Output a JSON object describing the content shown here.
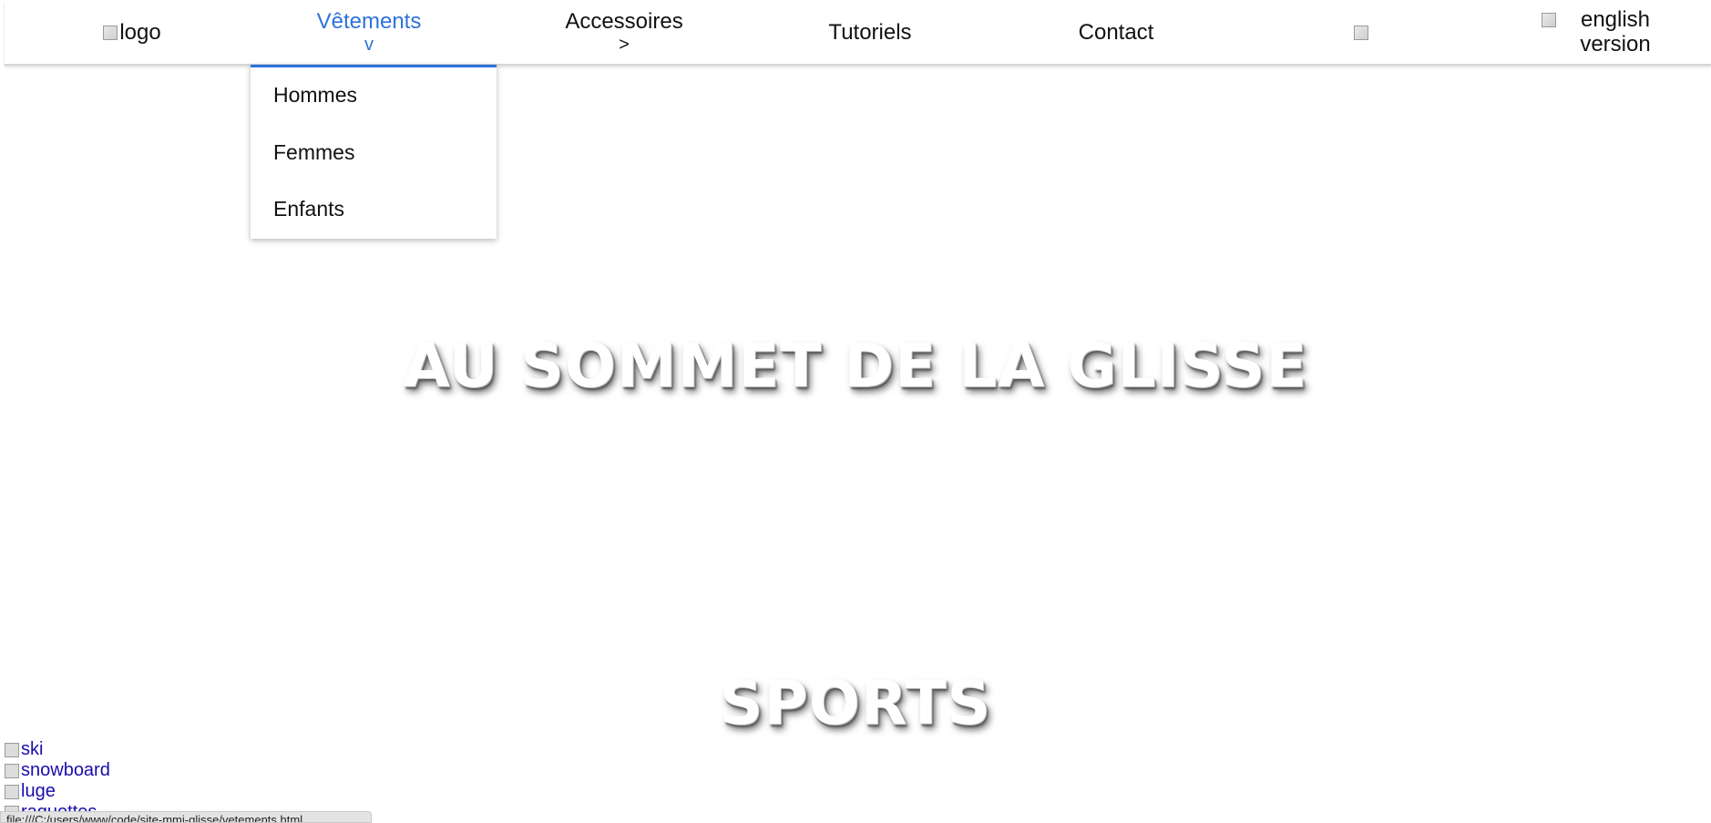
{
  "nav": {
    "logo_alt": "logo",
    "items": [
      {
        "label": "Vêtements",
        "indicator": "v"
      },
      {
        "label": "Accessoires",
        "indicator": ">"
      },
      {
        "label": "Tutoriels"
      },
      {
        "label": "Contact"
      }
    ],
    "english_alt": "english version",
    "active_color": "#2d73d9"
  },
  "dropdown": {
    "items": [
      "Hommes",
      "Femmes",
      "Enfants"
    ]
  },
  "hero": {
    "title": "AU SOMMET DE LA GLISSE",
    "sports_heading": "SPORTS"
  },
  "sports": [
    {
      "alt": "ski"
    },
    {
      "alt": "snowboard"
    },
    {
      "alt": "luge"
    },
    {
      "alt": "raquettes"
    }
  ],
  "statusbar": {
    "url": "file:///C:/users/www/code/site-mmi-glisse/vetements.html"
  }
}
